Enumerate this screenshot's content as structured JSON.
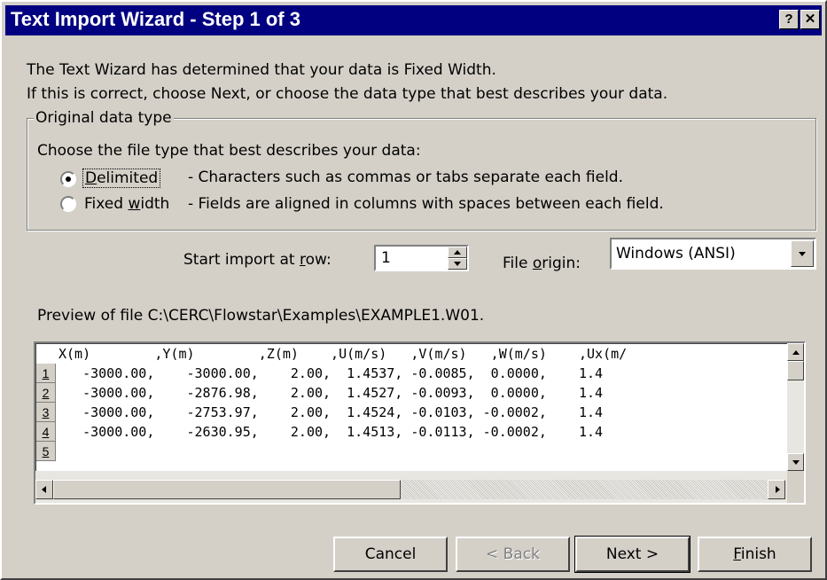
{
  "window": {
    "title": "Text Import Wizard - Step 1 of 3",
    "help_glyph": "?",
    "close_glyph": "✕"
  },
  "intro": {
    "line1": "The Text Wizard has determined that your data is Fixed Width.",
    "line2": "If this is correct, choose Next, or choose the data type that best describes your data."
  },
  "original_data_type": {
    "legend": "Original data type",
    "prompt": "Choose the file type that best describes your data:",
    "options": [
      {
        "label": "Delimited",
        "description": "- Characters such as commas or tabs separate each field.",
        "selected": true
      },
      {
        "label": "Fixed width",
        "description": "- Fields are aligned in columns with spaces between each field.",
        "selected": false
      }
    ]
  },
  "start_row": {
    "label": "Start import at row:",
    "value": "1"
  },
  "file_origin": {
    "label": "File origin:",
    "value": "Windows (ANSI)"
  },
  "preview": {
    "label": "Preview of file C:\\CERC\\Flowstar\\Examples\\EXAMPLE1.W01.",
    "rows": [
      {
        "num": "1",
        "text": "X(m)        ,Y(m)        ,Z(m)    ,U(m/s)   ,V(m/s)   ,W(m/s)    ,Ux(m/"
      },
      {
        "num": "2",
        "text": "   -3000.00,    -3000.00,    2.00,  1.4537, -0.0085,  0.0000,    1.4"
      },
      {
        "num": "3",
        "text": "   -3000.00,    -2876.98,    2.00,  1.4527, -0.0093,  0.0000,    1.4"
      },
      {
        "num": "4",
        "text": "   -3000.00,    -2753.97,    2.00,  1.4524, -0.0103, -0.0002,    1.4"
      },
      {
        "num": "5",
        "text": "   -3000.00,    -2630.95,    2.00,  1.4513, -0.0113, -0.0002,    1.4"
      }
    ]
  },
  "buttons": {
    "cancel": "Cancel",
    "back": "< Back",
    "next": "Next >",
    "finish": "Finish"
  },
  "colors": {
    "titlebar": "#000080",
    "face": "#d4d0c8"
  }
}
